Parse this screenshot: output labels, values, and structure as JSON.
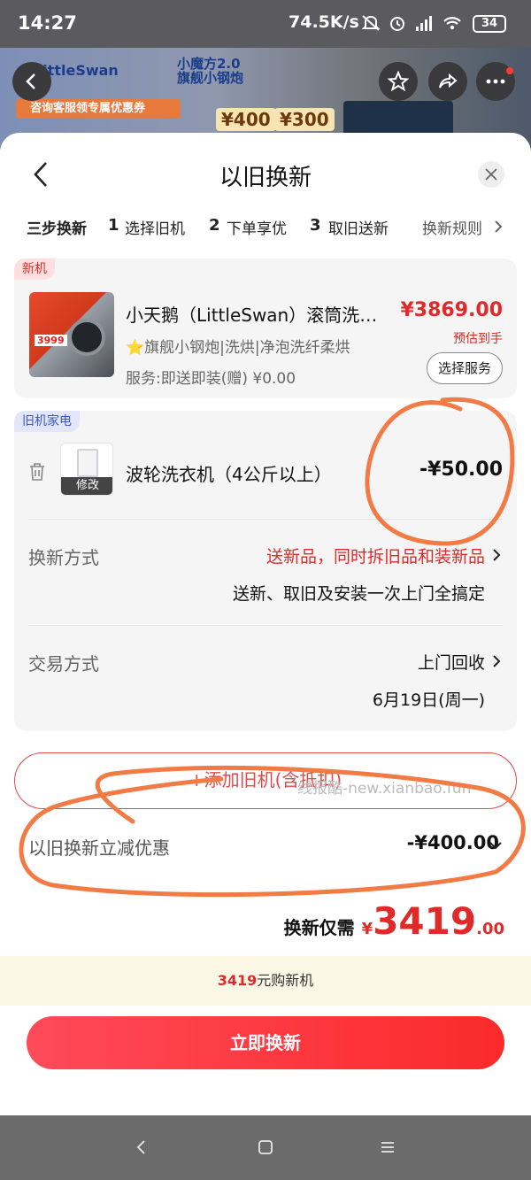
{
  "status_bar": {
    "time": "14:27",
    "network_speed": "74.5K/s",
    "battery": "34"
  },
  "background_page": {
    "brand": "LittleSwan",
    "brand_series": "小魔方2.0 旗舰小钢炮",
    "promo": "咨询客服领专属优惠券",
    "coupons": [
      "¥400",
      "¥300"
    ]
  },
  "sheet": {
    "title": "以旧换新"
  },
  "steps": {
    "label": "三步换新",
    "items": [
      {
        "num": "1",
        "text": "选择旧机"
      },
      {
        "num": "2",
        "text": "下单享优"
      },
      {
        "num": "3",
        "text": "取旧送新"
      }
    ],
    "rules": "换新规则"
  },
  "new_machine": {
    "tag": "新机",
    "thumb_price": "3999",
    "name": "小天鹅（LittleSwan）滚筒洗衣机",
    "subtitle_star": "⭐",
    "subtitle": "旗舰小钢炮|洗烘|净泡洗纤柔烘",
    "service": "服务:即送即装(赠) ¥0.00",
    "price": "¥3869.00",
    "price_note": "预估到手",
    "service_button": "选择服务"
  },
  "old_machine": {
    "tag": "旧机家电",
    "edit_label": "修改",
    "name": "波轮洗衣机（4公斤以上）",
    "price": "-¥50.00",
    "exchange_method_label": "换新方式",
    "exchange_method_value": "送新品，同时拆旧品和装新品",
    "exchange_method_note": "送新、取旧及安装一次上门全搞定",
    "trade_method_label": "交易方式",
    "trade_method_value": "上门回收",
    "trade_date": "6月19日(周一)"
  },
  "add_old_button": "+添加旧机(含抵扣)",
  "discount": {
    "label": "以旧换新立减优惠",
    "value": "-¥400.00"
  },
  "total": {
    "label": "换新仅需",
    "currency": "¥",
    "integer": "3419",
    "decimal": ".00"
  },
  "notice": {
    "amount": "3419",
    "text": "元购新机"
  },
  "main_button": "立即换新",
  "watermark": "线报酷-new.xianbao.fun",
  "colors": {
    "accent_red": "#e02a2a",
    "annotation_orange": "#f27a45"
  }
}
